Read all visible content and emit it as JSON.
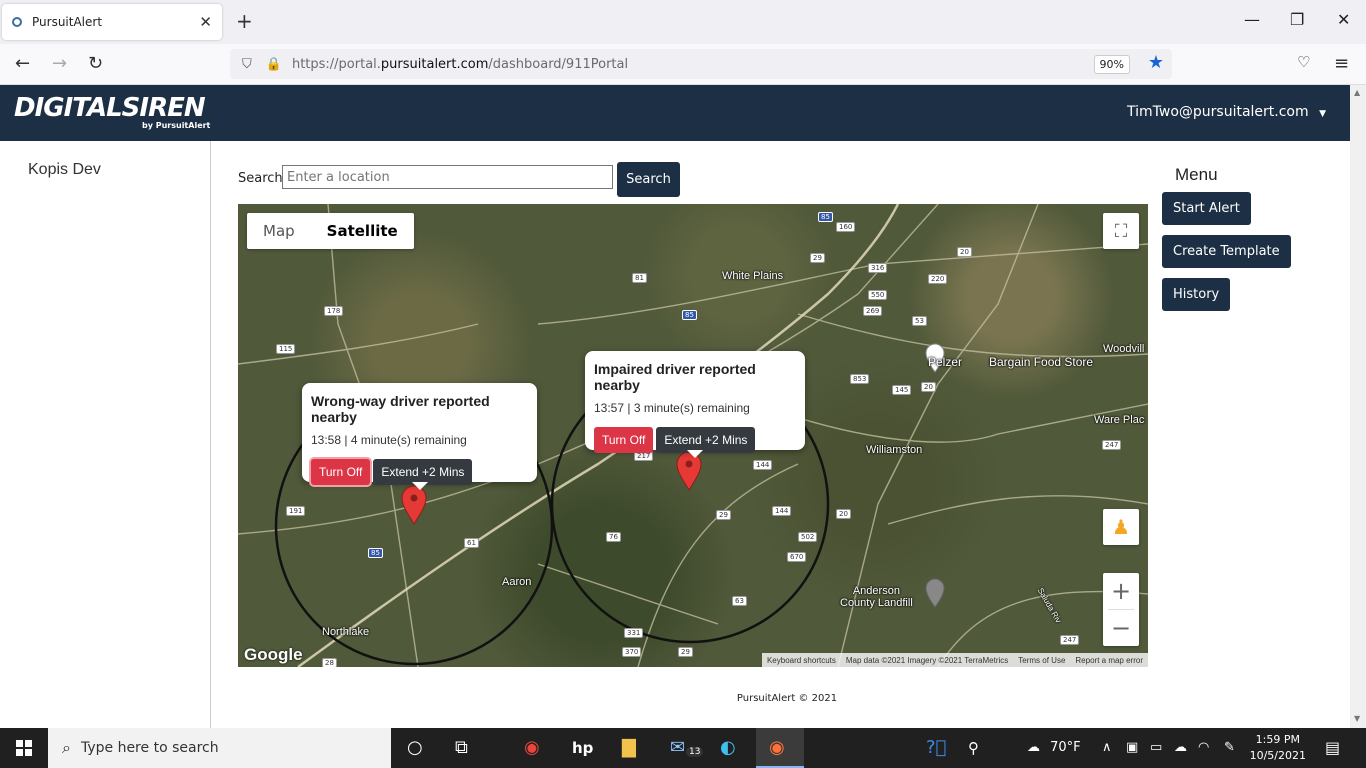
{
  "browser": {
    "tab_title": "PursuitAlert",
    "url_prefix": "https://portal.",
    "url_domain": "pursuitalert.com",
    "url_path": "/dashboard/911Portal",
    "zoom": "90%"
  },
  "header": {
    "logo": "DIGITALSIREN",
    "logo_sub": "by PursuitAlert",
    "user": "TimTwo@pursuitalert.com"
  },
  "sidebar": {
    "org": "Kopis Dev"
  },
  "search": {
    "label": "Search",
    "placeholder": "Enter a location",
    "button": "Search"
  },
  "map": {
    "type_map": "Map",
    "type_satellite": "Satellite",
    "places": {
      "white_plains": "White Plains",
      "pelzer": "Pelzer",
      "bargain": "Bargain Food Store",
      "woodville": "Woodvill",
      "ware_place": "Ware Plac",
      "williamston": "Williamston",
      "aaron": "Aaron",
      "northlake": "Northlake",
      "anderson": "Anderson\nCounty Landfill",
      "saluda": "Saluda Riv"
    },
    "google": "Google",
    "attr_keyboard": "Keyboard shortcuts",
    "attr_data": "Map data ©2021 Imagery ©2021 TerraMetrics",
    "attr_terms": "Terms of Use",
    "attr_report": "Report a map error"
  },
  "alerts": [
    {
      "title": "Wrong-way driver reported nearby",
      "meta": "13:58 | 4 minute(s) remaining",
      "off": "Turn Off",
      "extend": "Extend +2 Mins"
    },
    {
      "title": "Impaired driver reported nearby",
      "meta": "13:57 | 3 minute(s) remaining",
      "off": "Turn Off",
      "extend": "Extend +2 Mins"
    }
  ],
  "menu": {
    "title": "Menu",
    "start_alert": "Start Alert",
    "create_template": "Create Template",
    "history": "History"
  },
  "footer": "PursuitAlert © 2021",
  "taskbar": {
    "search": "Type here to search",
    "weather": "70°F",
    "time": "1:59 PM",
    "date": "10/5/2021",
    "mail_count": "13"
  },
  "colors": {
    "navy": "#1c2f44",
    "danger": "#dc3545",
    "dark": "#343a40"
  }
}
